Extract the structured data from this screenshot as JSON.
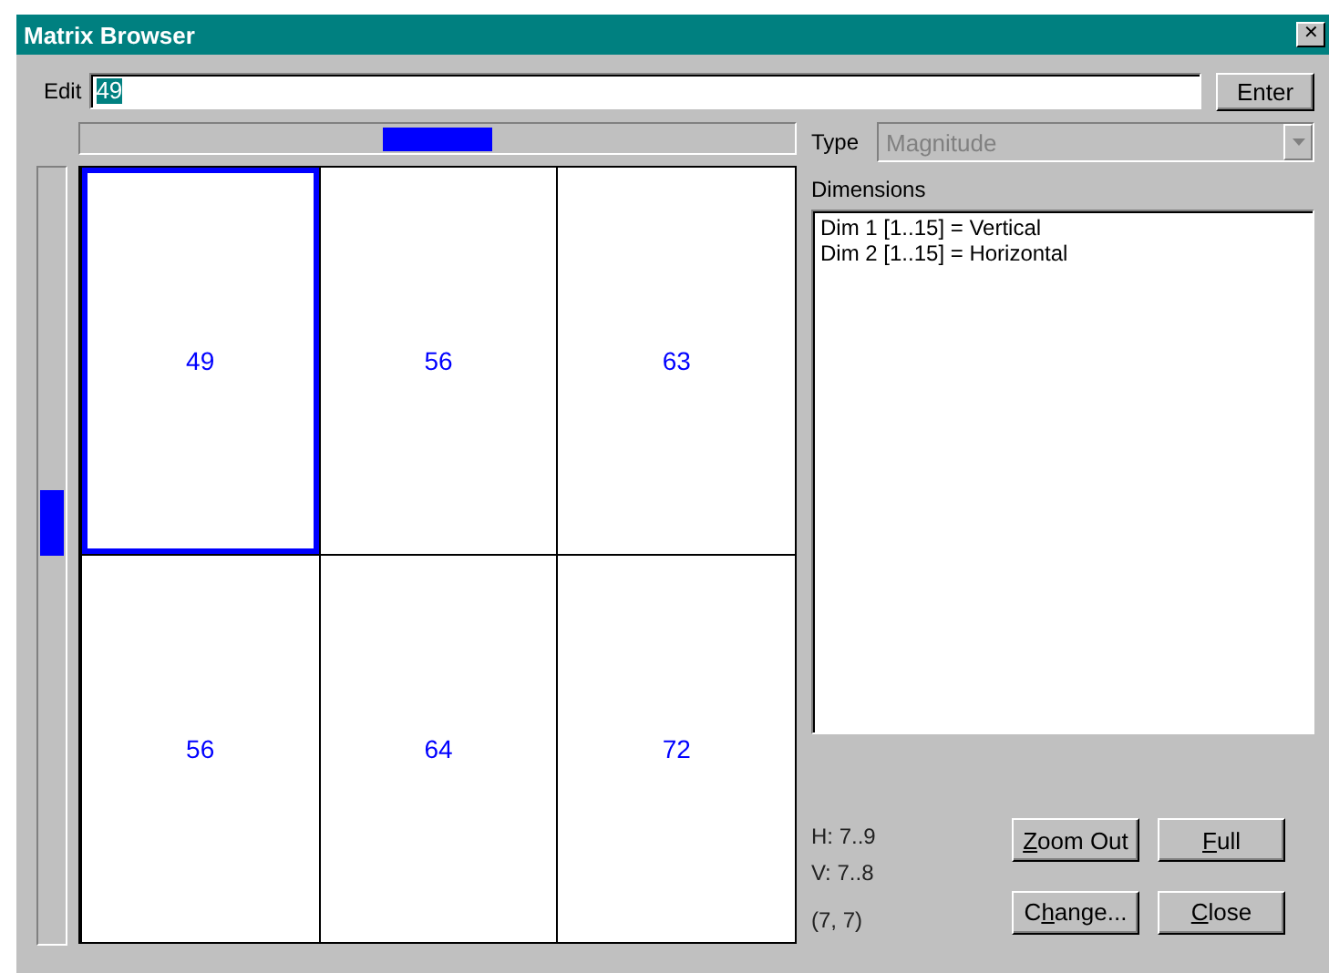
{
  "window": {
    "title": "Matrix Browser",
    "close": "✕"
  },
  "edit": {
    "label": "Edit",
    "value": "49",
    "button": "Enter"
  },
  "type": {
    "label": "Type",
    "value": "Magnitude",
    "disabled": true
  },
  "dimensions": {
    "label": "Dimensions",
    "items": [
      "Dim 1 [1..15] = Vertical",
      "Dim 2 [1..15] = Horizontal"
    ]
  },
  "grid": {
    "rows": [
      [
        {
          "value": "49",
          "selected": true
        },
        {
          "value": "56",
          "selected": false
        },
        {
          "value": "63",
          "selected": false
        }
      ],
      [
        {
          "value": "56",
          "selected": false
        },
        {
          "value": "64",
          "selected": false
        },
        {
          "value": "72",
          "selected": false
        }
      ]
    ]
  },
  "info": {
    "h": "H: 7..9",
    "v": "V: 7..8",
    "position": "(7, 7)"
  },
  "buttons": [
    {
      "key": "Z",
      "post": "oom Out"
    },
    {
      "key": "F",
      "post": "ull"
    },
    {
      "pre": "C",
      "key": "h",
      "post": "ange..."
    },
    {
      "key": "C",
      "post": "lose"
    }
  ]
}
